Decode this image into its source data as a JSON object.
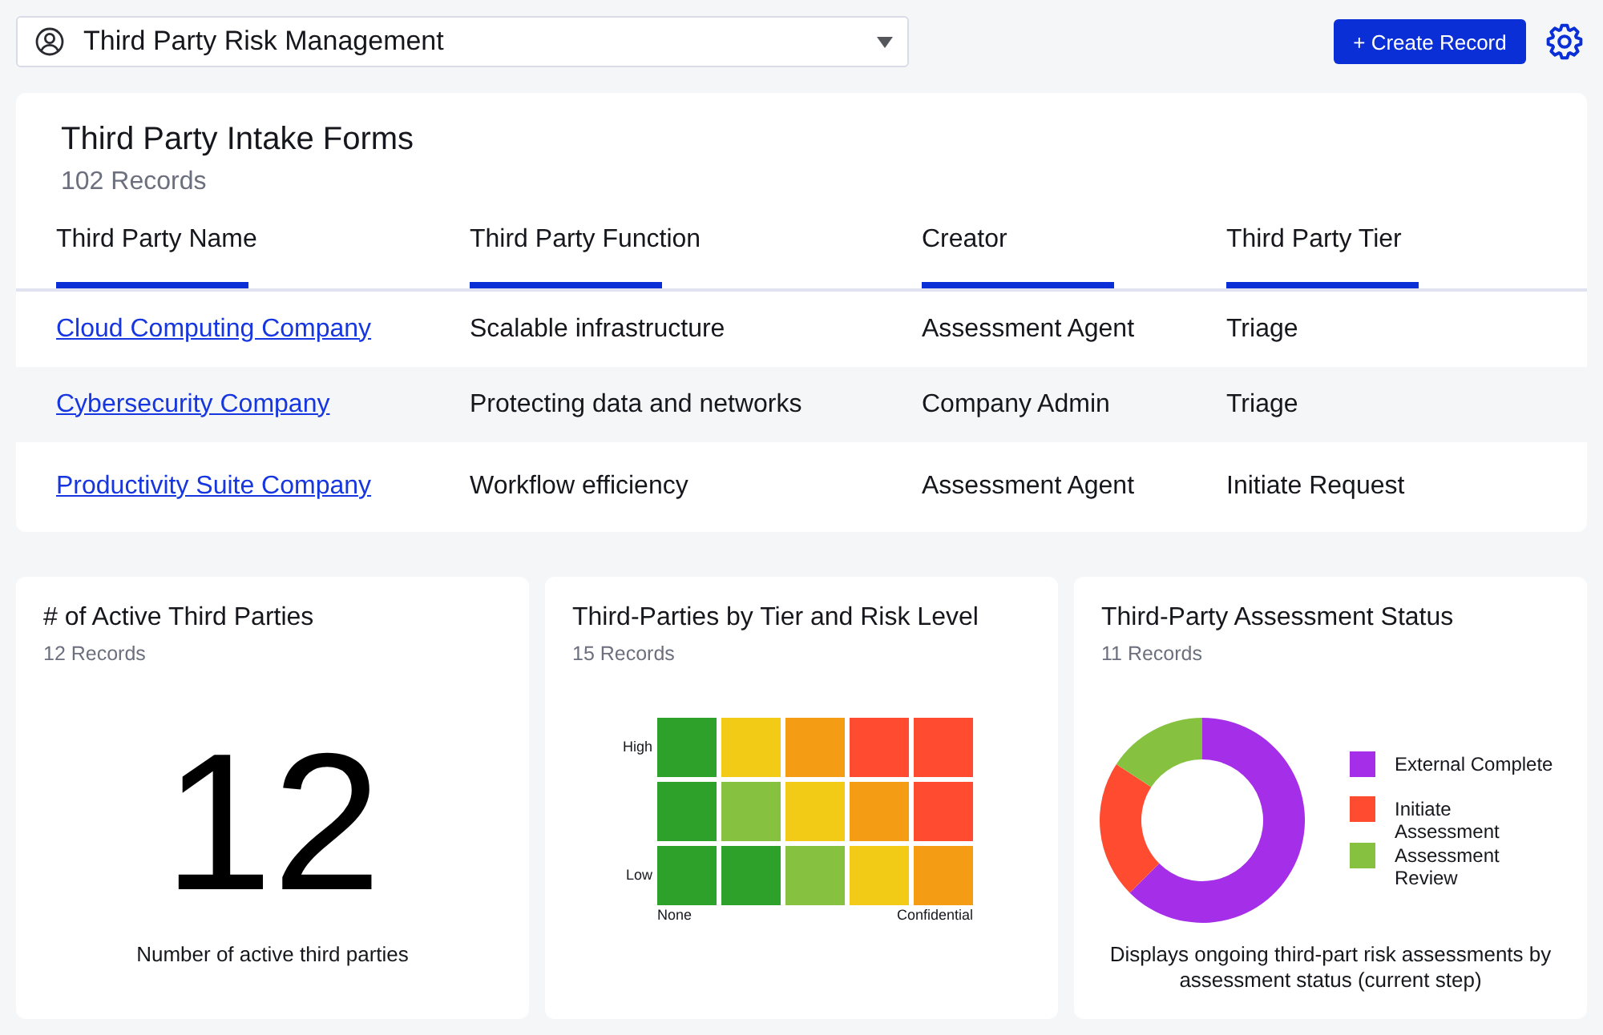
{
  "toolbar": {
    "workspace_selector": {
      "value": "Third Party Risk Management"
    },
    "create_button": {
      "label": "+ Create Record"
    }
  },
  "intake_forms": {
    "title": "Third Party Intake Forms",
    "record_count": "102 Records",
    "columns": [
      "Third Party Name",
      "Third Party Function",
      "Creator",
      "Third Party Tier"
    ],
    "rows": [
      {
        "name": "Cloud Computing Company",
        "function": "Scalable infrastructure",
        "creator": "Assessment Agent",
        "tier": "Triage"
      },
      {
        "name": "Cybersecurity Company",
        "function": "Protecting data and networks",
        "creator": "Company Admin",
        "tier": "Triage"
      },
      {
        "name": "Productivity Suite Company",
        "function": "Workflow efficiency",
        "creator": "Assessment Agent",
        "tier": "Initiate Request"
      }
    ]
  },
  "widgets": [
    {
      "kind": "metric",
      "title": "# of Active Third Parties",
      "record_count": "12 Records",
      "value": "12",
      "caption": "Number of active third parties"
    },
    {
      "kind": "risk_matrix",
      "title": "Third-Parties by Tier and Risk Level",
      "record_count": "15 Records",
      "rows": [
        {
          "label": "High",
          "cells": [
            {
              "color": "#2ea12b"
            },
            {
              "color": "#f2cb17"
            },
            {
              "color": "#f39c14"
            },
            {
              "color": "#ff4b30"
            },
            {
              "color": "#ff4b30"
            }
          ]
        },
        {
          "cells": [
            {
              "color": "#2ea12b"
            },
            {
              "color": "#86c240"
            },
            {
              "color": "#f2cb17"
            },
            {
              "color": "#f39c14"
            },
            {
              "color": "#ff4b30"
            }
          ]
        },
        {
          "label": "Low",
          "cells": [
            {
              "color": "#2ea12b"
            },
            {
              "color": "#2ea12b"
            },
            {
              "color": "#86c240"
            },
            {
              "color": "#f2cb17"
            },
            {
              "color": "#f39c14"
            }
          ]
        }
      ],
      "x_axis": {
        "start_label": "None",
        "end_label": "Confidential"
      }
    },
    {
      "kind": "donut",
      "title": "Third-Party Assessment Status",
      "record_count": "11 Records",
      "chart_data": {
        "type": "donut",
        "values": [
          62.5,
          21.7,
          15.8
        ]
      },
      "legend": [
        {
          "label": "External Complete",
          "color": "#a52ee8"
        },
        {
          "label": "Initiate Assessment",
          "color": "#ff4b30"
        },
        {
          "label": "Assessment Review",
          "color": "#86c240"
        }
      ],
      "caption": "Displays ongoing third-part risk assessments by assessment status (current step)"
    }
  ]
}
